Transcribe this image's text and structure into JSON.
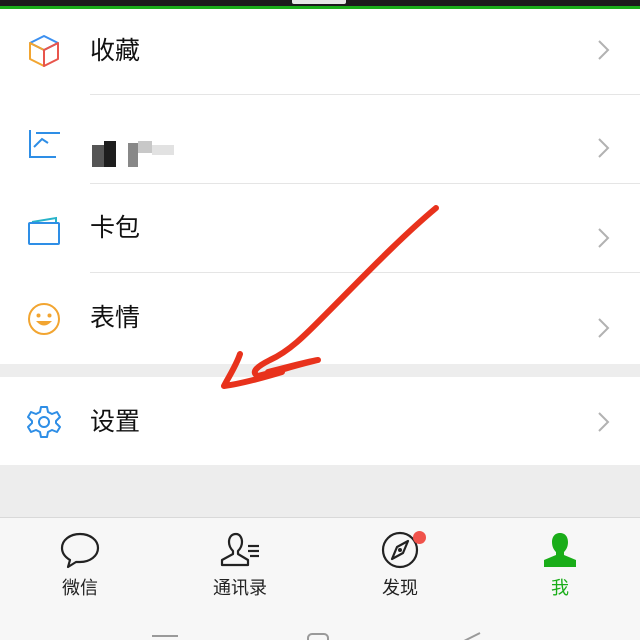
{
  "menu": {
    "items": [
      {
        "label": "收藏",
        "icon": "favorites-cube-icon"
      },
      {
        "label": "",
        "icon": "album-icon"
      },
      {
        "label": "卡包",
        "icon": "card-wallet-icon"
      },
      {
        "label": "表情",
        "icon": "sticker-smiley-icon"
      }
    ],
    "settings": {
      "label": "设置",
      "icon": "gear-icon"
    }
  },
  "tabbar": {
    "tabs": [
      {
        "label": "微信",
        "icon": "chat-bubble-icon"
      },
      {
        "label": "通讯录",
        "icon": "contacts-icon"
      },
      {
        "label": "发现",
        "icon": "compass-icon"
      },
      {
        "label": "我",
        "icon": "person-icon"
      }
    ],
    "active_index": 3
  },
  "annotation": {
    "type": "red-hand-drawn-arrow",
    "color": "#e8321c",
    "points_to": "设置"
  },
  "colors": {
    "accent": "#1aad19",
    "badge": "#f0524b",
    "icon_blue": "#2e8ee6",
    "icon_orange": "#f2a531"
  }
}
